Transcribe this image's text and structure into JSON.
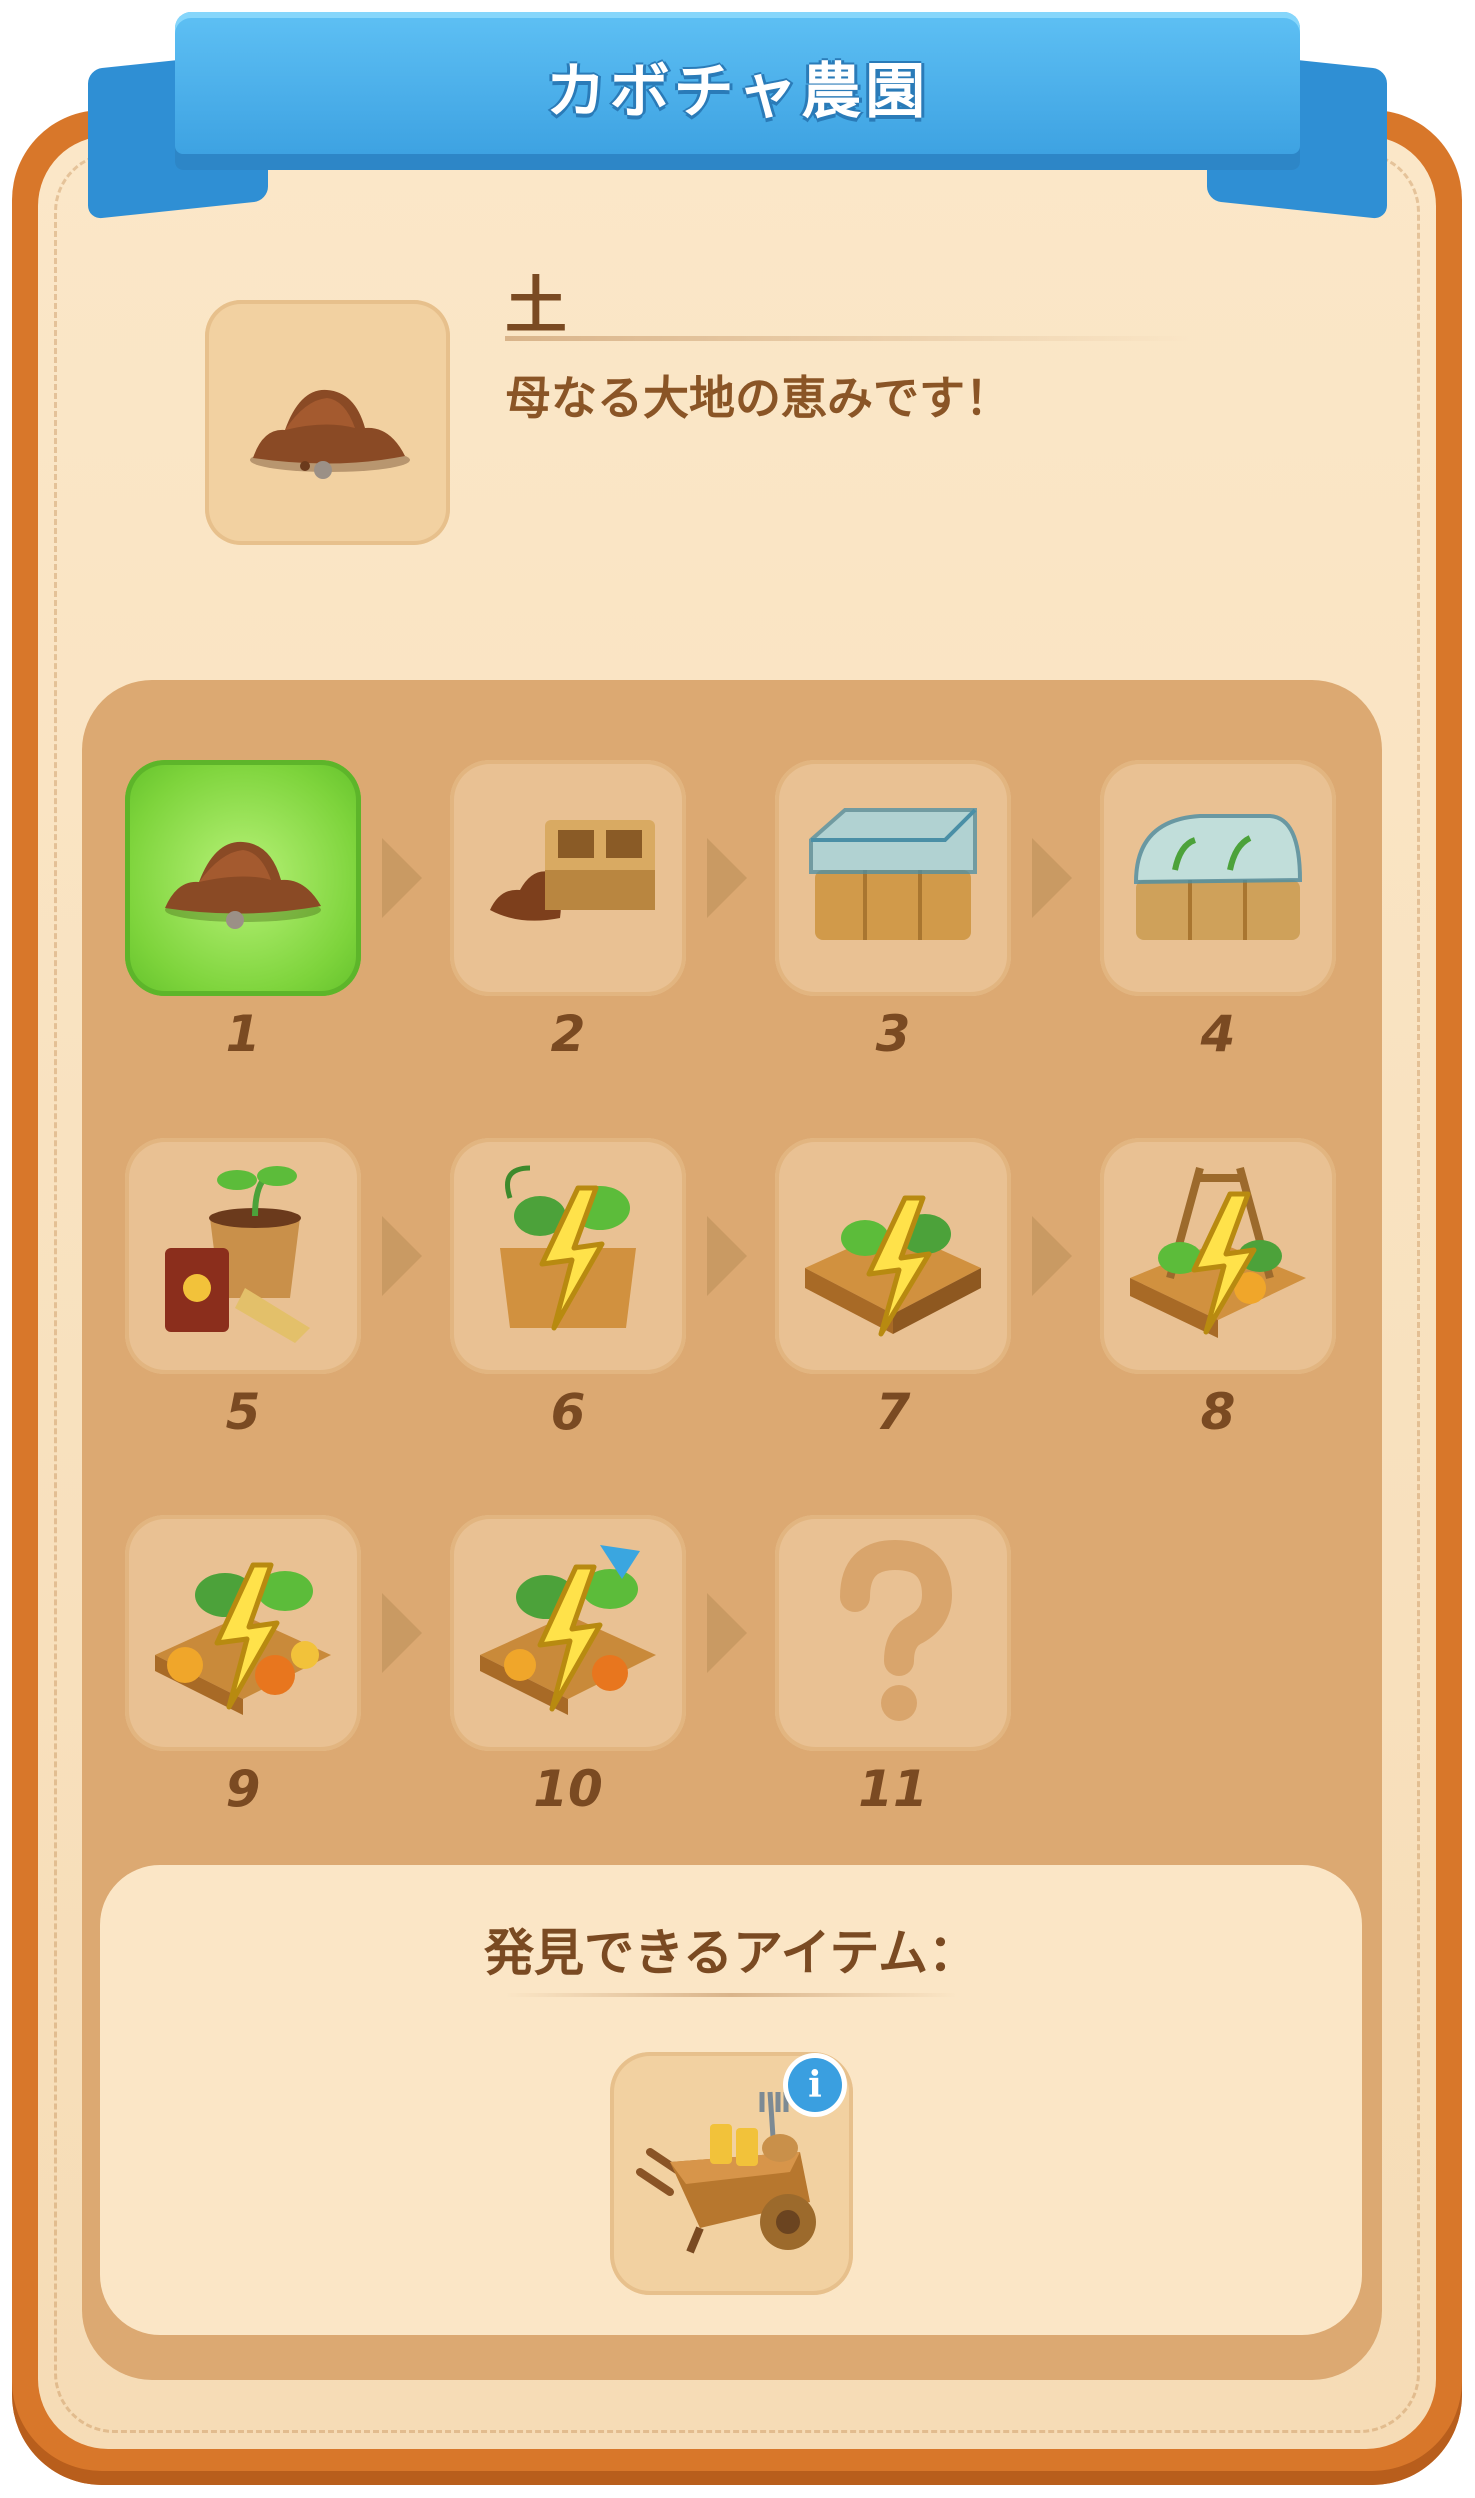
{
  "banner": {
    "title": "カボチャ農園"
  },
  "item": {
    "name": "土",
    "description": "母なる大地の恵みです！",
    "icon": "soil-pile-icon"
  },
  "chain": {
    "items": [
      {
        "number": "1",
        "icon": "soil-pile-icon",
        "active": true
      },
      {
        "number": "2",
        "icon": "seed-tray-icon"
      },
      {
        "number": "3",
        "icon": "glass-box-icon"
      },
      {
        "number": "4",
        "icon": "mini-greenhouse-icon"
      },
      {
        "number": "5",
        "icon": "sprout-pot-gloves-icon"
      },
      {
        "number": "6",
        "icon": "vine-crate-energy-icon"
      },
      {
        "number": "7",
        "icon": "garden-bed-energy-icon"
      },
      {
        "number": "8",
        "icon": "trellis-bed-energy-icon"
      },
      {
        "number": "9",
        "icon": "pumpkin-patch-energy-icon"
      },
      {
        "number": "10",
        "icon": "pumpkin-garden-energy-icon"
      },
      {
        "number": "11",
        "icon": "question-mark-icon",
        "locked": true
      }
    ]
  },
  "discoverable": {
    "title": "発見できるアイテム：",
    "item_icon": "wheelbarrow-icon",
    "info_icon": "i"
  },
  "colors": {
    "active_green": "#7ed43c",
    "banner_blue": "#3a9fe0",
    "panel_orange": "#d8772a",
    "text_brown": "#7a4a22"
  }
}
